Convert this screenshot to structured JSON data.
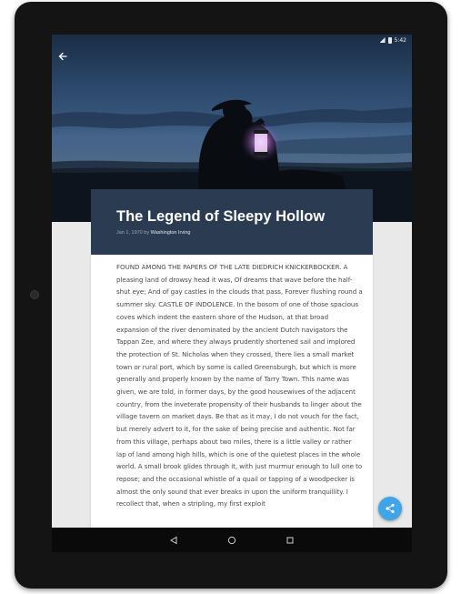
{
  "statusbar": {
    "time": "5:42"
  },
  "story": {
    "title": "The Legend of Sleepy Hollow",
    "date_by": "Jan 1, 1970 by ",
    "author": "Washington Irving",
    "text": "FOUND AMONG THE PAPERS OF THE LATE DIEDRICH KNICKERBOCKER. A pleasing land of drowsy head it was, Of dreams that wave before the half-shut eye; And of gay castles in the clouds that pass, Forever flushing round a summer sky. CASTLE OF INDOLENCE. In the bosom of one of those spacious coves which indent the eastern shore of the Hudson, at that broad expansion of the river denominated by the ancient Dutch navigators the Tappan Zee, and where they always prudently shortened sail and implored the protection of St. Nicholas when they crossed, there lies a small market town or rural port, which by some is called Greensburgh, but which is more generally and properly known by the name of Tarry Town. This name was given, we are told, in former days, by the good housewives of the adjacent country, from the inveterate propensity of their husbands to linger about the village tavern on market days. Be that as it may, I do not vouch for the fact, but merely advert to it, for the sake of being precise and authentic. Not far from this village, perhaps about two miles, there is a little valley or rather lap of land among high hills, which is one of the quietest places in the whole world. A small brook glides through it, with just murmur enough to lull one to repose; and the occasional whistle of a quail or tapping of a woodpecker is almost the only sound that ever breaks in upon the uniform tranquillity. I recollect that, when a stripling, my first exploit"
  },
  "icons": {
    "back": "arrow-back-icon",
    "share": "share-icon",
    "nav_back": "triangle-back-icon",
    "nav_home": "circle-home-icon",
    "nav_recents": "square-recents-icon"
  },
  "colors": {
    "header_bg": "#2b3c52",
    "fab": "#3fa4e8",
    "text": "#4a4a4a"
  }
}
